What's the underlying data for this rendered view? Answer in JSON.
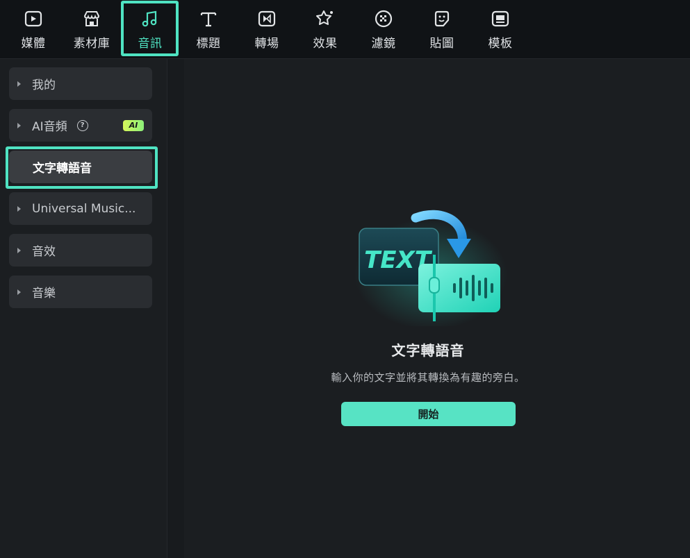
{
  "toolbar": {
    "items": [
      {
        "label": "媒體",
        "icon": "media-icon"
      },
      {
        "label": "素材庫",
        "icon": "store-icon"
      },
      {
        "label": "音訊",
        "icon": "music-note-icon",
        "active": true
      },
      {
        "label": "標題",
        "icon": "title-t-icon"
      },
      {
        "label": "轉場",
        "icon": "transition-icon"
      },
      {
        "label": "效果",
        "icon": "effects-star-icon"
      },
      {
        "label": "濾鏡",
        "icon": "filter-icon"
      },
      {
        "label": "貼圖",
        "icon": "sticker-icon"
      },
      {
        "label": "模板",
        "icon": "template-icon"
      }
    ]
  },
  "sidebar": {
    "items": [
      {
        "label": "我的"
      },
      {
        "label": "AI音頻",
        "badge": "AI"
      },
      {
        "label": "文字轉語音",
        "selected": true
      },
      {
        "label": "Universal Music..."
      },
      {
        "label": "音效"
      },
      {
        "label": "音樂"
      }
    ]
  },
  "main": {
    "illustration_text": "TEXT",
    "title": "文字轉語音",
    "description": "輸入你的文字並將其轉換為有趣的旁白。",
    "start_label": "開始"
  },
  "colors": {
    "accent": "#4fe3c2",
    "button": "#57e3c4",
    "background": "#1b1e21",
    "topbar": "#101316"
  }
}
